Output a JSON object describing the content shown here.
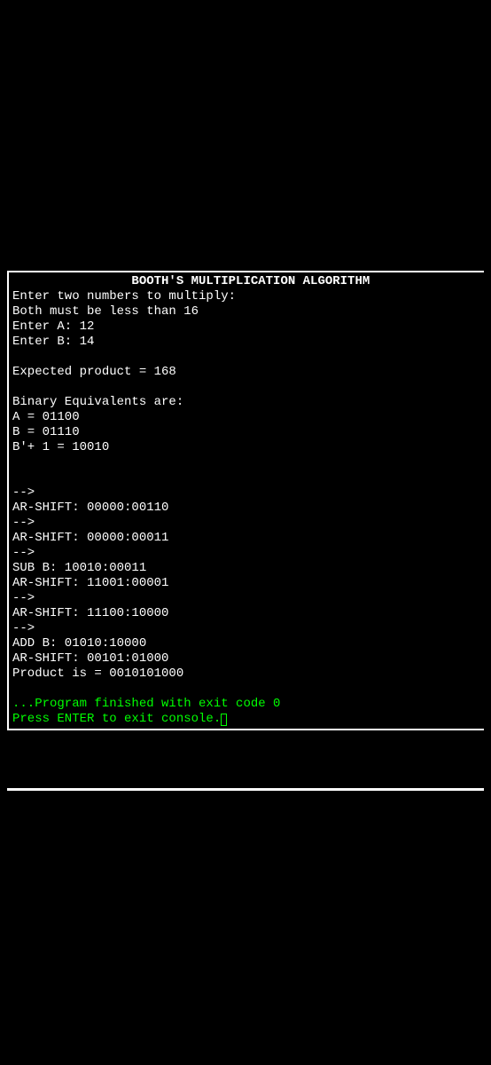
{
  "console": {
    "title": "                BOOTH'S MULTIPLICATION ALGORITHM",
    "lines": [
      {
        "text": "Enter two numbers to multiply:",
        "color": "white"
      },
      {
        "text": "Both must be less than 16",
        "color": "white"
      },
      {
        "text": "Enter A: 12",
        "color": "white"
      },
      {
        "text": "Enter B: 14",
        "color": "white"
      },
      {
        "text": "",
        "color": "white"
      },
      {
        "text": "Expected product = 168",
        "color": "white"
      },
      {
        "text": "",
        "color": "white"
      },
      {
        "text": "Binary Equivalents are:",
        "color": "white"
      },
      {
        "text": "A = 01100",
        "color": "white"
      },
      {
        "text": "B = 01110",
        "color": "white"
      },
      {
        "text": "B'+ 1 = 10010",
        "color": "white"
      },
      {
        "text": "",
        "color": "white"
      },
      {
        "text": "",
        "color": "white"
      },
      {
        "text": "-->",
        "color": "white"
      },
      {
        "text": "AR-SHIFT: 00000:00110",
        "color": "white"
      },
      {
        "text": "-->",
        "color": "white"
      },
      {
        "text": "AR-SHIFT: 00000:00011",
        "color": "white"
      },
      {
        "text": "-->",
        "color": "white"
      },
      {
        "text": "SUB B: 10010:00011",
        "color": "white"
      },
      {
        "text": "AR-SHIFT: 11001:00001",
        "color": "white"
      },
      {
        "text": "-->",
        "color": "white"
      },
      {
        "text": "AR-SHIFT: 11100:10000",
        "color": "white"
      },
      {
        "text": "-->",
        "color": "white"
      },
      {
        "text": "ADD B: 01010:10000",
        "color": "white"
      },
      {
        "text": "AR-SHIFT: 00101:01000",
        "color": "white"
      },
      {
        "text": "Product is = 0010101000",
        "color": "white"
      },
      {
        "text": "",
        "color": "white"
      },
      {
        "text": "...Program finished with exit code 0",
        "color": "green"
      },
      {
        "text": "Press ENTER to exit console.",
        "color": "green",
        "cursor": true
      }
    ]
  }
}
